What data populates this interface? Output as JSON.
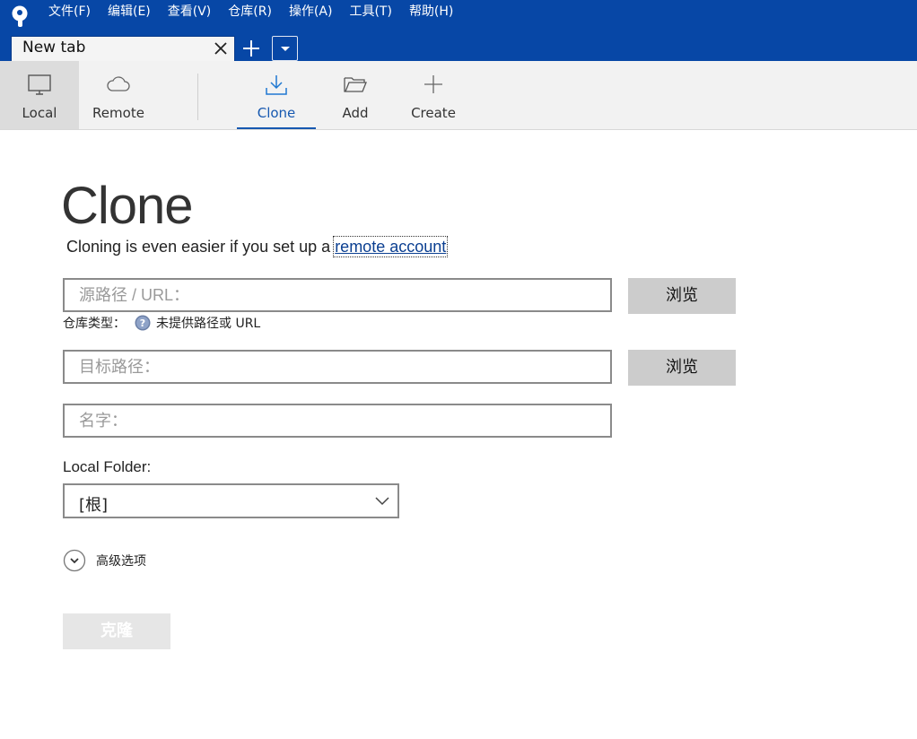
{
  "menubar": {
    "items": [
      "文件(F)",
      "编辑(E)",
      "查看(V)",
      "仓库(R)",
      "操作(A)",
      "工具(T)",
      "帮助(H)"
    ]
  },
  "tabs": {
    "active_label": "New tab"
  },
  "toolbar": {
    "local": "Local",
    "remote": "Remote",
    "clone": "Clone",
    "add": "Add",
    "create": "Create"
  },
  "main": {
    "title": "Clone",
    "subtitle_prefix": "Cloning is even easier if you set up a",
    "subtitle_link": "remote account",
    "source_placeholder": "源路径 / URL：",
    "browse_label": "浏览",
    "repo_type_label": "仓库类型：",
    "repo_type_value": "未提供路径或 URL",
    "dest_placeholder": "目标路径：",
    "name_placeholder": "名字：",
    "local_folder_label": "Local Folder:",
    "local_folder_value": "[根]",
    "advanced_label": "高级选项",
    "clone_button": "克隆"
  },
  "colors": {
    "menubar_bg": "#0747a6",
    "accent": "#1658b0",
    "toolbar_bg": "#f2f2f2",
    "browse_bg": "#cccccc",
    "disabled_button_bg": "#e6e6e6"
  },
  "icons": [
    "app-logo-icon",
    "close-icon",
    "plus-icon",
    "dropdown-icon",
    "monitor-icon",
    "cloud-icon",
    "download-icon",
    "folder-open-icon",
    "plus-icon",
    "help-icon",
    "chevron-down-icon"
  ]
}
